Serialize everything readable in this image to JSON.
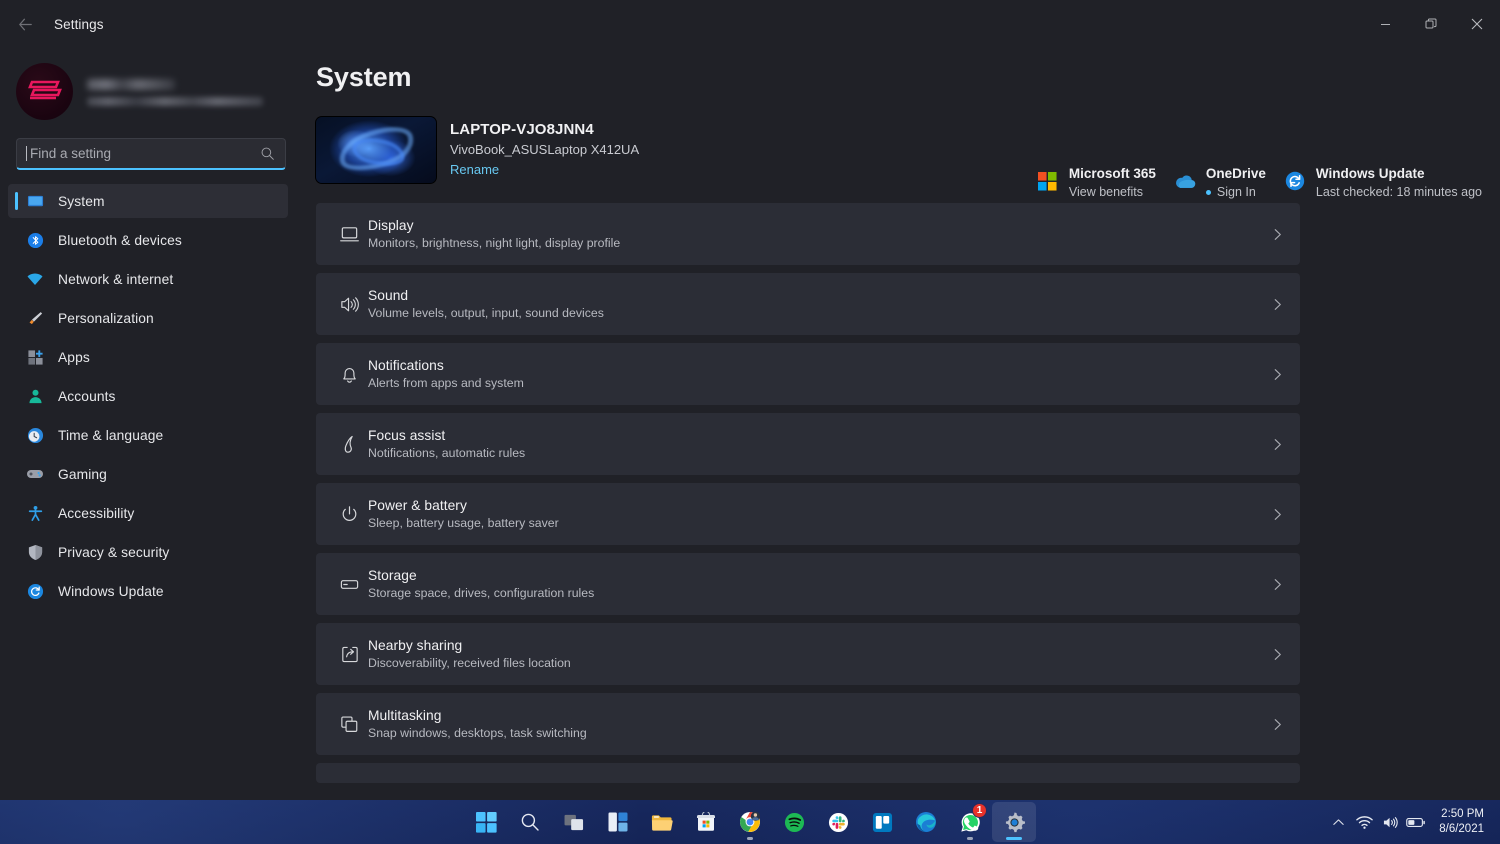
{
  "window": {
    "title": "Settings",
    "back_label": "Back",
    "controls": {
      "minimize": "Minimize",
      "maximize": "Restore",
      "close": "Close"
    }
  },
  "account": {
    "name_redacted": "",
    "email_redacted": ""
  },
  "search": {
    "placeholder": "Find a setting",
    "value": ""
  },
  "sidebar": {
    "items": [
      {
        "label": "System",
        "icon": "monitor-icon",
        "selected": true
      },
      {
        "label": "Bluetooth & devices",
        "icon": "bluetooth-icon",
        "selected": false
      },
      {
        "label": "Network & internet",
        "icon": "wifi-icon",
        "selected": false
      },
      {
        "label": "Personalization",
        "icon": "paintbrush-icon",
        "selected": false
      },
      {
        "label": "Apps",
        "icon": "apps-icon",
        "selected": false
      },
      {
        "label": "Accounts",
        "icon": "person-icon",
        "selected": false
      },
      {
        "label": "Time & language",
        "icon": "clock-icon",
        "selected": false
      },
      {
        "label": "Gaming",
        "icon": "gamepad-icon",
        "selected": false
      },
      {
        "label": "Accessibility",
        "icon": "accessibility-icon",
        "selected": false
      },
      {
        "label": "Privacy & security",
        "icon": "shield-icon",
        "selected": false
      },
      {
        "label": "Windows Update",
        "icon": "update-icon",
        "selected": false
      }
    ]
  },
  "main": {
    "page_title": "System",
    "device": {
      "name": "LAPTOP-VJO8JNN4",
      "model": "VivoBook_ASUSLaptop X412UA",
      "rename_label": "Rename"
    },
    "quick_cards": [
      {
        "title": "Microsoft 365",
        "subtitle": "View benefits",
        "icon": "microsoft-365-icon",
        "has_dot": false
      },
      {
        "title": "OneDrive",
        "subtitle": "Sign In",
        "icon": "onedrive-icon",
        "has_dot": true
      },
      {
        "title": "Windows Update",
        "subtitle": "Last checked: 18 minutes ago",
        "icon": "windows-update-icon",
        "has_dot": false
      }
    ],
    "settings_rows": [
      {
        "title": "Display",
        "subtitle": "Monitors, brightness, night light, display profile",
        "icon": "display-icon"
      },
      {
        "title": "Sound",
        "subtitle": "Volume levels, output, input, sound devices",
        "icon": "sound-icon"
      },
      {
        "title": "Notifications",
        "subtitle": "Alerts from apps and system",
        "icon": "bell-icon"
      },
      {
        "title": "Focus assist",
        "subtitle": "Notifications, automatic rules",
        "icon": "moon-icon"
      },
      {
        "title": "Power & battery",
        "subtitle": "Sleep, battery usage, battery saver",
        "icon": "power-icon"
      },
      {
        "title": "Storage",
        "subtitle": "Storage space, drives, configuration rules",
        "icon": "storage-icon"
      },
      {
        "title": "Nearby sharing",
        "subtitle": "Discoverability, received files location",
        "icon": "share-icon"
      },
      {
        "title": "Multitasking",
        "subtitle": "Snap windows, desktops, task switching",
        "icon": "multitasking-icon"
      }
    ]
  },
  "taskbar": {
    "items": [
      {
        "name": "start-button",
        "label": "Start",
        "running": false,
        "active": false
      },
      {
        "name": "search-button",
        "label": "Search",
        "running": false,
        "active": false
      },
      {
        "name": "task-view-button",
        "label": "Task View",
        "running": false,
        "active": false
      },
      {
        "name": "widgets-button",
        "label": "Widgets",
        "running": false,
        "active": false
      },
      {
        "name": "file-explorer",
        "label": "File Explorer",
        "running": false,
        "active": false
      },
      {
        "name": "microsoft-store",
        "label": "Microsoft Store",
        "running": false,
        "active": false
      },
      {
        "name": "google-chrome",
        "label": "Google Chrome",
        "running": true,
        "active": false
      },
      {
        "name": "spotify",
        "label": "Spotify",
        "running": false,
        "active": false
      },
      {
        "name": "slack",
        "label": "Slack",
        "running": false,
        "active": false
      },
      {
        "name": "trello",
        "label": "Trello",
        "running": false,
        "active": false
      },
      {
        "name": "microsoft-edge",
        "label": "Microsoft Edge",
        "running": false,
        "active": false
      },
      {
        "name": "whatsapp",
        "label": "WhatsApp",
        "running": true,
        "active": false,
        "badge": "1"
      },
      {
        "name": "settings",
        "label": "Settings",
        "running": true,
        "active": true
      }
    ],
    "tray": {
      "overflow_label": "Show hidden icons",
      "wifi_label": "Network",
      "volume_label": "Volume",
      "battery_label": "Battery",
      "time": "2:50 PM",
      "date": "8/6/2021"
    }
  },
  "colors": {
    "accent": "#4cc2ff",
    "window_bg": "#202127",
    "card_bg": "#2b2d36",
    "taskbar_bg": "#17285f",
    "badge_red": "#e8322a",
    "link": "#68c8f0"
  }
}
